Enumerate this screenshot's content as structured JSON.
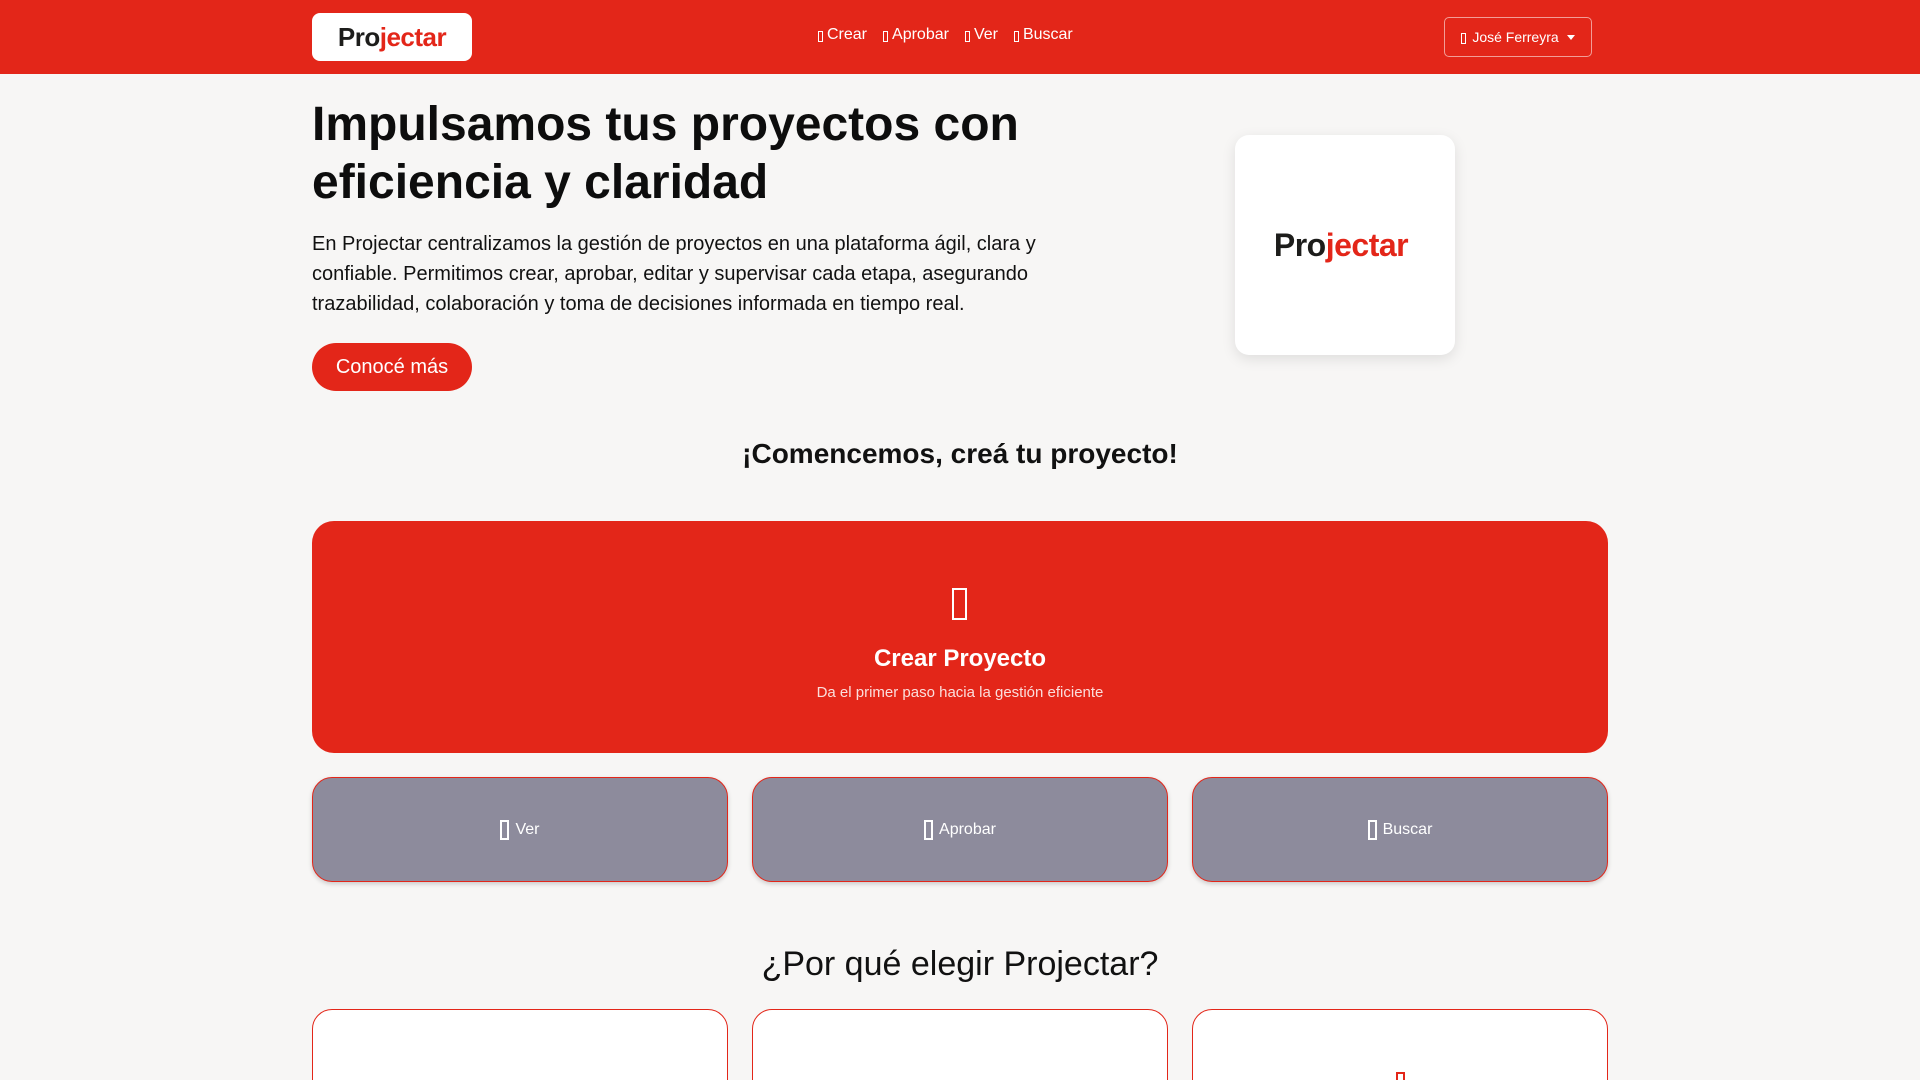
{
  "brand": {
    "name_part1": "Pro",
    "name_part2": "jectar",
    "accent_color": "#e32619",
    "dark_color": "#1d1d1b"
  },
  "nav": {
    "items": [
      {
        "label": "Crear",
        "icon": "plus-icon"
      },
      {
        "label": "Aprobar",
        "icon": "check-icon"
      },
      {
        "label": "Ver",
        "icon": "eye-icon"
      },
      {
        "label": "Buscar",
        "icon": "search-icon"
      }
    ],
    "user_name": "José Ferreyra"
  },
  "hero": {
    "title": "Impulsamos tus proyectos con eficiencia y claridad",
    "description": "En Projectar centralizamos la gestión de proyectos en una plataforma ágil, clara y confiable. Permitimos crear, aprobar, editar y supervisar cada etapa, asegurando trazabilidad, colaboración y toma de decisiones informada en tiempo real.",
    "cta_label": "Conocé más"
  },
  "start": {
    "title": "¡Comencemos, creá tu proyecto!",
    "create_title": "Crear Proyecto",
    "create_subtitle": "Da el primer paso hacia la gestión eficiente",
    "actions": [
      {
        "label": "Ver",
        "icon": "eye-icon"
      },
      {
        "label": "Aprobar",
        "icon": "check-icon"
      },
      {
        "label": "Buscar",
        "icon": "search-icon"
      }
    ]
  },
  "why": {
    "title": "¿Por qué elegir Projectar?"
  },
  "colors": {
    "primary": "#e32619",
    "background": "#f7f6f5",
    "action_button": "#8d8b9c"
  }
}
